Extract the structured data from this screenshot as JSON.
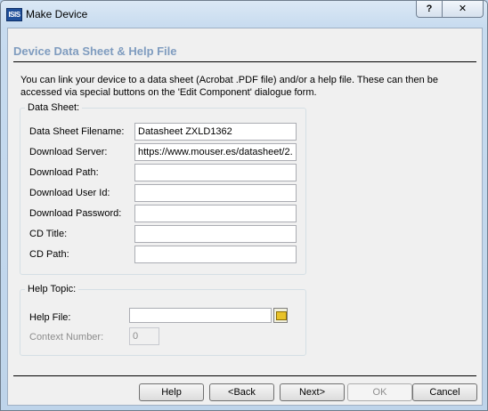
{
  "window": {
    "title": "Make Device",
    "icon_text": "ISIS",
    "help_glyph": "?",
    "close_glyph": "✕"
  },
  "page": {
    "heading": "Device Data Sheet & Help File",
    "intro": "You can link your device to a data sheet (Acrobat .PDF file) and/or a help file. These can then be accessed via special buttons on the 'Edit Component' dialogue form."
  },
  "data_sheet": {
    "group_title": "Data Sheet:",
    "filename": {
      "label": "Data Sheet Filename:",
      "value": "Datasheet ZXLD1362"
    },
    "server": {
      "label": "Download Server:",
      "value": "https://www.mouser.es/datasheet/2."
    },
    "path": {
      "label": "Download Path:",
      "value": ""
    },
    "user_id": {
      "label": "Download User Id:",
      "value": ""
    },
    "password": {
      "label": "Download Password:",
      "value": ""
    },
    "cd_title": {
      "label": "CD Title:",
      "value": ""
    },
    "cd_path": {
      "label": "CD Path:",
      "value": ""
    }
  },
  "help_topic": {
    "group_title": "Help Topic:",
    "help_file": {
      "label": "Help File:",
      "value": ""
    },
    "context_number": {
      "label": "Context Number:",
      "value": "0"
    }
  },
  "buttons": {
    "help": "Help",
    "back": "<Back",
    "next": "Next>",
    "ok": "OK",
    "cancel": "Cancel"
  },
  "icons": {
    "app": "isis-app-icon",
    "browse": "folder-icon"
  }
}
